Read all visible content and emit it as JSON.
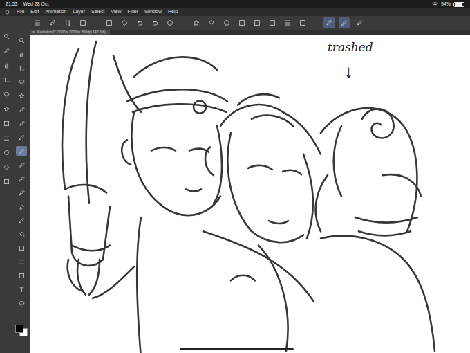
{
  "status_bar": {
    "time": "21:53",
    "date": "Wed 28 Oct",
    "battery": "94%",
    "battery_level": 0.94
  },
  "menu": [
    "File",
    "Edit",
    "Animation",
    "Layer",
    "Select",
    "View",
    "Filter",
    "Window",
    "Help"
  ],
  "command_bar": [
    {
      "selected": false
    },
    {
      "selected": false
    },
    {
      "selected": false
    },
    {
      "selected": false
    },
    {
      "selected": false
    },
    {
      "selected": false
    },
    {
      "selected": false
    },
    {
      "selected": false
    },
    {
      "selected": false
    },
    {
      "selected": false
    },
    {
      "selected": false
    },
    {
      "selected": false
    },
    {
      "selected": false
    },
    {
      "selected": false
    },
    {
      "selected": false
    },
    {
      "selected": false
    },
    {
      "selected": false
    },
    {
      "selected": true
    },
    {
      "selected": true
    },
    {
      "selected": false
    }
  ],
  "document_tab": {
    "title": "Illustration2* (3000 x 2000px 350dpi 142.1%)",
    "close": "×"
  },
  "left_tools": [
    {
      "selected": false
    },
    {
      "selected": false
    },
    {
      "selected": false
    },
    {
      "selected": false
    },
    {
      "selected": false
    },
    {
      "selected": false
    },
    {
      "selected": false
    },
    {
      "selected": false
    },
    {
      "selected": false
    },
    {
      "selected": false
    },
    {
      "selected": false
    }
  ],
  "tool_palette": [
    {
      "selected": false
    },
    {
      "selected": false
    },
    {
      "selected": false
    },
    {
      "selected": false
    },
    {
      "selected": false
    },
    {
      "selected": false
    },
    {
      "selected": false
    },
    {
      "selected": false
    },
    {
      "selected": true
    },
    {
      "selected": false
    },
    {
      "selected": false
    },
    {
      "selected": false
    },
    {
      "selected": false
    },
    {
      "selected": false
    },
    {
      "selected": false
    },
    {
      "selected": false
    },
    {
      "selected": false
    },
    {
      "selected": false
    },
    {
      "selected": false
    },
    {
      "selected": false
    }
  ],
  "colors": {
    "main": "#000000",
    "sub": "#ffffff"
  },
  "canvas": {
    "annotation": "trashed",
    "arrow": "↓"
  }
}
